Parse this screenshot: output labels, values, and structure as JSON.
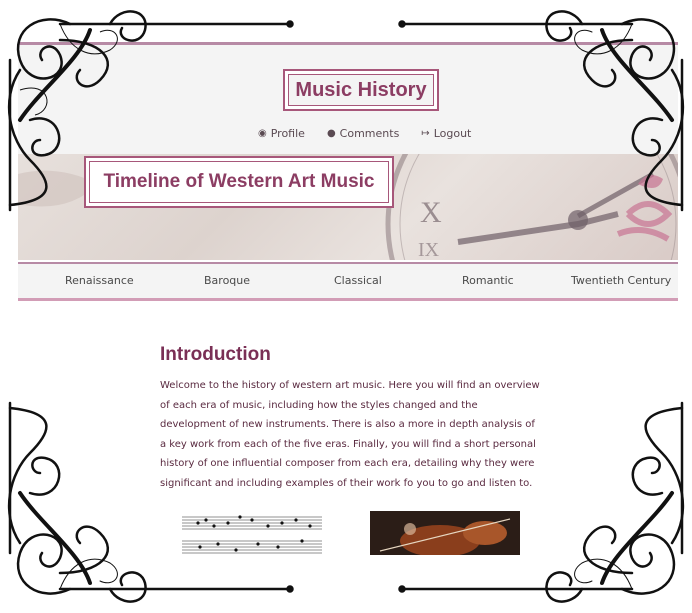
{
  "header": {
    "site_title": "Music History",
    "nav": [
      {
        "icon": "user-circle-icon",
        "label": "Profile"
      },
      {
        "icon": "speech-bubble-icon",
        "label": "Comments"
      },
      {
        "icon": "sign-out-icon",
        "label": "Logout"
      }
    ]
  },
  "banner": {
    "title": "Timeline of Western Art Music"
  },
  "eras": [
    "Renaissance",
    "Baroque",
    "Classical",
    "Romantic",
    "Twentieth Century"
  ],
  "intro": {
    "heading": "Introduction",
    "body": "Welcome to the history of western art music. Here you will find an overview of each era of music, including how the styles changed and the development of new instruments. There is also a more in depth analysis of a key work from each of the five eras. Finally, you will find a short personal history of one influential composer from each era, detailing why they were significant and including examples of their work fo you to go and listen to."
  },
  "colors": {
    "accent": "#8c3d63",
    "border": "#b78aa5",
    "header_bg": "#f4f4f4"
  }
}
